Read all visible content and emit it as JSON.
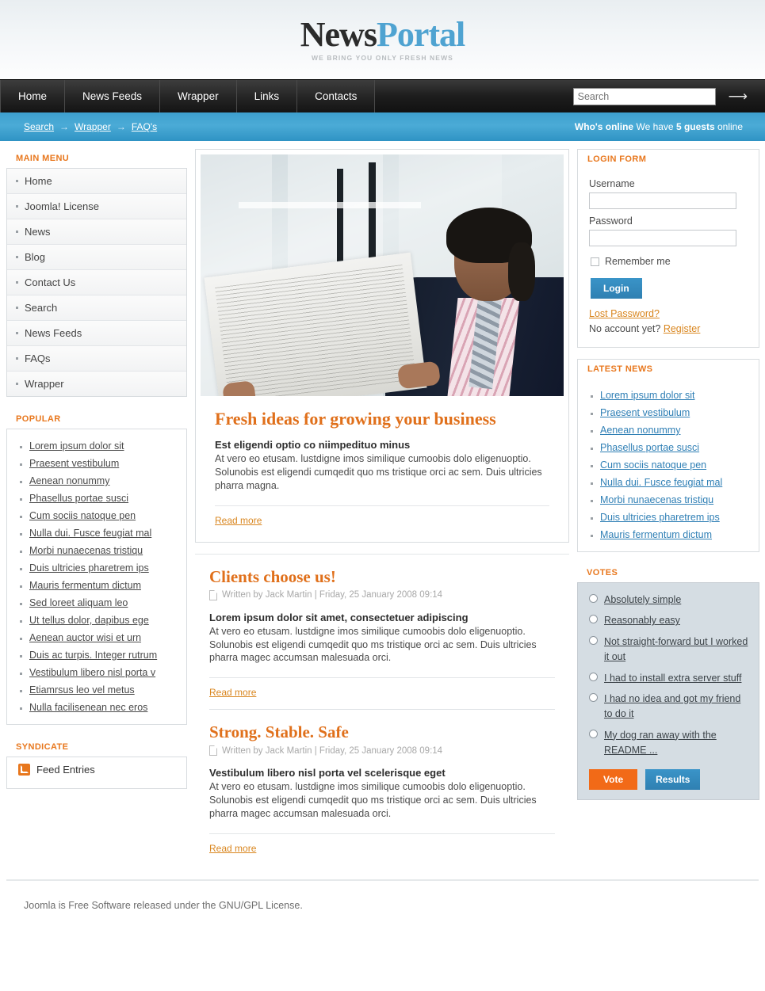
{
  "site": {
    "logo_primary": "News",
    "logo_secondary": "Portal",
    "tagline": "WE BRING YOU ONLY FRESH NEWS"
  },
  "nav": {
    "items": [
      "Home",
      "News Feeds",
      "Wrapper",
      "Links",
      "Contacts"
    ],
    "search_placeholder": "Search",
    "search_value": "",
    "search_submit_icon": "arrow-right-icon"
  },
  "subbar": {
    "breadcrumbs": [
      "Search",
      "Wrapper",
      "FAQ's"
    ],
    "separator": "→",
    "whosonline_label": "Who's online",
    "whosonline_text_a": "We have",
    "whosonline_count": "5 guests",
    "whosonline_text_b": "online"
  },
  "sidebar": {
    "main_menu": {
      "title": "MAIN MENU",
      "items": [
        "Home",
        "Joomla! License",
        "News",
        "Blog",
        "Contact Us",
        "Search",
        "News Feeds",
        "FAQs",
        "Wrapper"
      ]
    },
    "popular": {
      "title": "POPULAR",
      "items": [
        "Lorem ipsum dolor sit",
        "Praesent vestibulum",
        "Aenean nonummy",
        "Phasellus portae susci",
        "Cum sociis natoque pen",
        "Nulla dui. Fusce feugiat mal",
        "Morbi nunaecenas tristiqu",
        "Duis ultricies pharetrem ips",
        "Mauris fermentum dictum",
        "Sed loreet aliquam leo",
        "Ut tellus dolor, dapibus ege",
        "Aenean auctor wisi et urn",
        "Duis ac turpis. Integer rutrum",
        "Vestibulum libero nisl porta v",
        "Etiamrsus leo vel metus",
        "Nulla facilisenean nec eros"
      ]
    },
    "syndicate": {
      "title": "SYNDICATE",
      "feed_label": "Feed Entries",
      "icon": "rss-icon"
    }
  },
  "main": {
    "hero_image_alt": "businessman-reading-newspaper",
    "articles": [
      {
        "title": "Fresh ideas for growing your business",
        "byline": "",
        "lead": "Est eligendi optio co niimpedituo minus",
        "body": "At vero eo etusam. lustdigne imos similique cumoobis  dolo eligenuoptio. Solunobis est eligendi cumqedit quo ms tristique orci ac sem. Duis ultricies pharra magna.",
        "readmore": "Read more"
      },
      {
        "title": "Clients choose us!",
        "byline": "Written by Jack Martin  |  Friday, 25 January 2008 09:14",
        "lead": "Lorem ipsum dolor sit amet, consectetuer adipiscing",
        "body": "At vero eo etusam. lustdigne imos similique cumoobis  dolo eligenuoptio. Solunobis est eligendi cumqedit quo ms tristique orci ac sem. Duis ultricies pharra magec accumsan malesuada orci.",
        "readmore": "Read more"
      },
      {
        "title": "Strong. Stable. Safe",
        "byline": "Written by Jack Martin  |  Friday, 25 January 2008 09:14",
        "lead": "Vestibulum libero nisl porta vel scelerisque eget",
        "body": "At vero eo etusam. lustdigne imos similique cumoobis  dolo eligenuoptio. Solunobis est eligendi cumqedit quo ms tristique orci ac sem. Duis ultricies pharra magec accumsan malesuada orci.",
        "readmore": "Read more"
      }
    ]
  },
  "right": {
    "login": {
      "title": "LOGIN FORM",
      "username_label": "Username",
      "username_value": "",
      "password_label": "Password",
      "password_value": "",
      "remember_label": "Remember me",
      "login_button": "Login",
      "lost_password": "Lost Password?",
      "no_account_text": "No account yet?",
      "register_link": "Register"
    },
    "latest_news": {
      "title": "LATEST NEWS",
      "items": [
        "Lorem ipsum dolor sit",
        "Praesent vestibulum",
        "Aenean nonummy",
        "Phasellus portae susci",
        "Cum sociis natoque pen",
        "Nulla dui. Fusce feugiat mal",
        "Morbi nunaecenas tristiqu",
        "Duis ultricies pharetrem ips",
        "Mauris fermentum dictum"
      ]
    },
    "votes": {
      "title": "VOTES",
      "options": [
        "Absolutely simple",
        "Reasonably easy",
        "Not straight-forward but I worked it out",
        "I had to install extra server stuff",
        "I had no idea and got my friend to do it",
        "My dog ran away with the README ..."
      ],
      "vote_button": "Vote",
      "results_button": "Results"
    }
  },
  "footer": {
    "text": "Joomla is Free Software released under the GNU/GPL License."
  },
  "colors": {
    "accent_orange": "#e8771d",
    "accent_blue": "#4babd6",
    "vote_orange": "#f26a17",
    "link_blue": "#2f7fb5"
  }
}
